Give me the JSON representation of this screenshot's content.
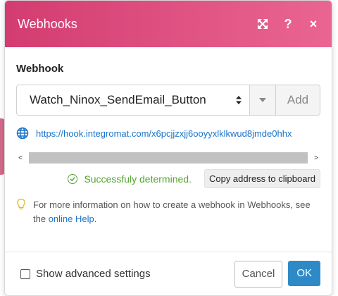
{
  "dialog": {
    "title": "Webhooks",
    "header_icons": [
      "expand-icon",
      "help-icon",
      "close-icon"
    ],
    "help_glyph": "?",
    "close_glyph": "×"
  },
  "webhook": {
    "label": "Webhook",
    "selected_value": "Watch_Ninox_SendEmail_Button",
    "add_label": "Add",
    "url": "https://hook.integromat.com/x6pcjjzxjj6ooyyxlklkwud8jmde0hhx",
    "scroll_left": "<",
    "scroll_right": ">",
    "status_text": "Successfuly determined.",
    "copy_label": "Copy address to clipboard"
  },
  "hint": {
    "text_before": "For more information on how to create a webhook in Webhooks, see the ",
    "link_text": "online Help",
    "text_after": "."
  },
  "footer": {
    "advanced_label": "Show advanced settings",
    "advanced_checked": false,
    "cancel_label": "Cancel",
    "ok_label": "OK"
  },
  "colors": {
    "header_start": "#d33c70",
    "header_end": "#ea6592",
    "link": "#1a73c9",
    "success": "#52a52e",
    "primary_button": "#2d8ac7"
  }
}
